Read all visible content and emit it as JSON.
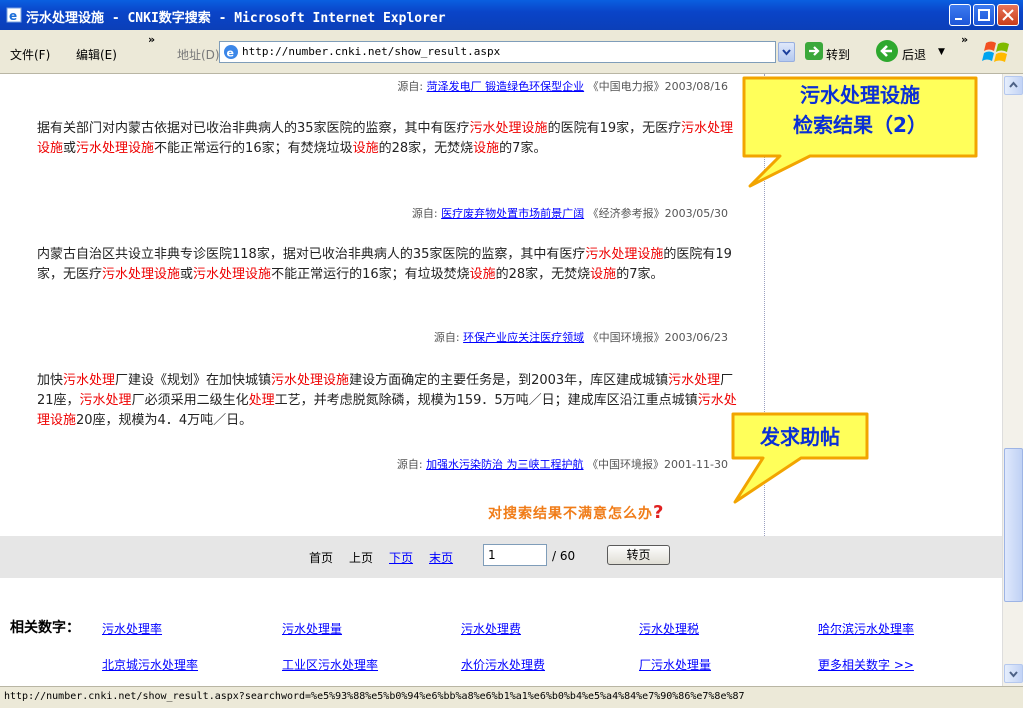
{
  "window": {
    "title": "污水处理设施 - CNKI数字搜索 - Microsoft Internet Explorer"
  },
  "toolbar": {
    "menu_file": "文件(F)",
    "menu_edit": "编辑(E)",
    "more": "»",
    "address_label": "地址(D)",
    "url": "http://number.cnki.net/show_result.aspx",
    "go_label": "转到",
    "back_label": "后退"
  },
  "results": [
    {
      "source_prefix": "源自:",
      "source_link": "菏泽发电厂 锻造绿色环保型企业",
      "source_pub": "《中国电力报》2003/08/16"
    },
    {
      "segments": [
        {
          "t": "据有关部门对内蒙古依据对已收治非典病人的35家医院的监察，其中有医疗",
          "h": false
        },
        {
          "t": "污水处理设施",
          "h": true
        },
        {
          "t": "的医院有19家，无医疗",
          "h": false
        },
        {
          "t": "污水处理设施",
          "h": true
        },
        {
          "t": "或",
          "h": false
        },
        {
          "t": "污水处理设施",
          "h": true
        },
        {
          "t": "不能正常运行的16家；有焚烧垃圾",
          "h": false
        },
        {
          "t": "设施",
          "h": true
        },
        {
          "t": "的28家，无焚烧",
          "h": false
        },
        {
          "t": "设施",
          "h": true
        },
        {
          "t": "的7家。",
          "h": false
        }
      ],
      "source_prefix": "源自:",
      "source_link": "医疗废弃物处置市场前景广阔",
      "source_pub": "《经济参考报》2003/05/30"
    },
    {
      "segments": [
        {
          "t": "内蒙古自治区共设立非典专诊医院118家，据对已收治非典病人的35家医院的监察，其中有医疗",
          "h": false
        },
        {
          "t": "污水处理设施",
          "h": true
        },
        {
          "t": "的医院有19家，无医疗",
          "h": false
        },
        {
          "t": "污水处理设施",
          "h": true
        },
        {
          "t": "或",
          "h": false
        },
        {
          "t": "污水处理设施",
          "h": true
        },
        {
          "t": "不能正常运行的16家；有垃圾焚烧",
          "h": false
        },
        {
          "t": "设施",
          "h": true
        },
        {
          "t": "的28家，无焚烧",
          "h": false
        },
        {
          "t": "设施",
          "h": true
        },
        {
          "t": "的7家。",
          "h": false
        }
      ],
      "source_prefix": "源自:",
      "source_link": "环保产业应关注医疗领域",
      "source_pub": "《中国环境报》2003/06/23"
    },
    {
      "segments": [
        {
          "t": "加快",
          "h": false
        },
        {
          "t": "污水处理",
          "h": true
        },
        {
          "t": "厂建设《规划》在加快城镇",
          "h": false
        },
        {
          "t": "污水处理设施",
          "h": true
        },
        {
          "t": "建设方面确定的主要任务是，到2003年，库区建成城镇",
          "h": false
        },
        {
          "t": "污水处理",
          "h": true
        },
        {
          "t": "厂21座，",
          "h": false
        },
        {
          "t": "污水处理",
          "h": true
        },
        {
          "t": "厂必须采用二级生化",
          "h": false
        },
        {
          "t": "处理",
          "h": true
        },
        {
          "t": "工艺，并考虑脱氮除磷，规模为159．5万吨／日；建成库区沿江重点城镇",
          "h": false
        },
        {
          "t": "污水处理设施",
          "h": true
        },
        {
          "t": "20座，规模为4．4万吨／日。",
          "h": false
        }
      ],
      "source_prefix": "源自:",
      "source_link": "加强水污染防治 为三峡工程护航",
      "source_pub": "《中国环境报》2001-11-30"
    }
  ],
  "callouts": {
    "search_results": "污水处理设施\n检索结果（2）",
    "post_help": "发求助帖"
  },
  "dissatisfied": {
    "text": "对搜索结果不满意怎么办",
    "q": "?"
  },
  "pager": {
    "first": "首页",
    "prev": "上页",
    "next": "下页",
    "last": "末页",
    "current_page": "1",
    "total": "/ 60",
    "jump_label": "转页"
  },
  "related": {
    "title": "相关数字：",
    "row1": [
      "污水处理率",
      "污水处理量",
      "污水处理费",
      "污水处理税",
      "哈尔滨污水处理率"
    ],
    "row2": [
      "北京城污水处理率",
      "工业区污水处理率",
      "水价污水处理费",
      "厂污水处理量",
      "更多相关数字 >>"
    ]
  },
  "statusbar": {
    "text": "http://number.cnki.net/show_result.aspx?searchword=%e5%93%88%e5%b0%94%e6%bb%a8%e6%b1%a1%e6%b0%b4%e5%a4%84%e7%90%86%e7%8e%87"
  }
}
